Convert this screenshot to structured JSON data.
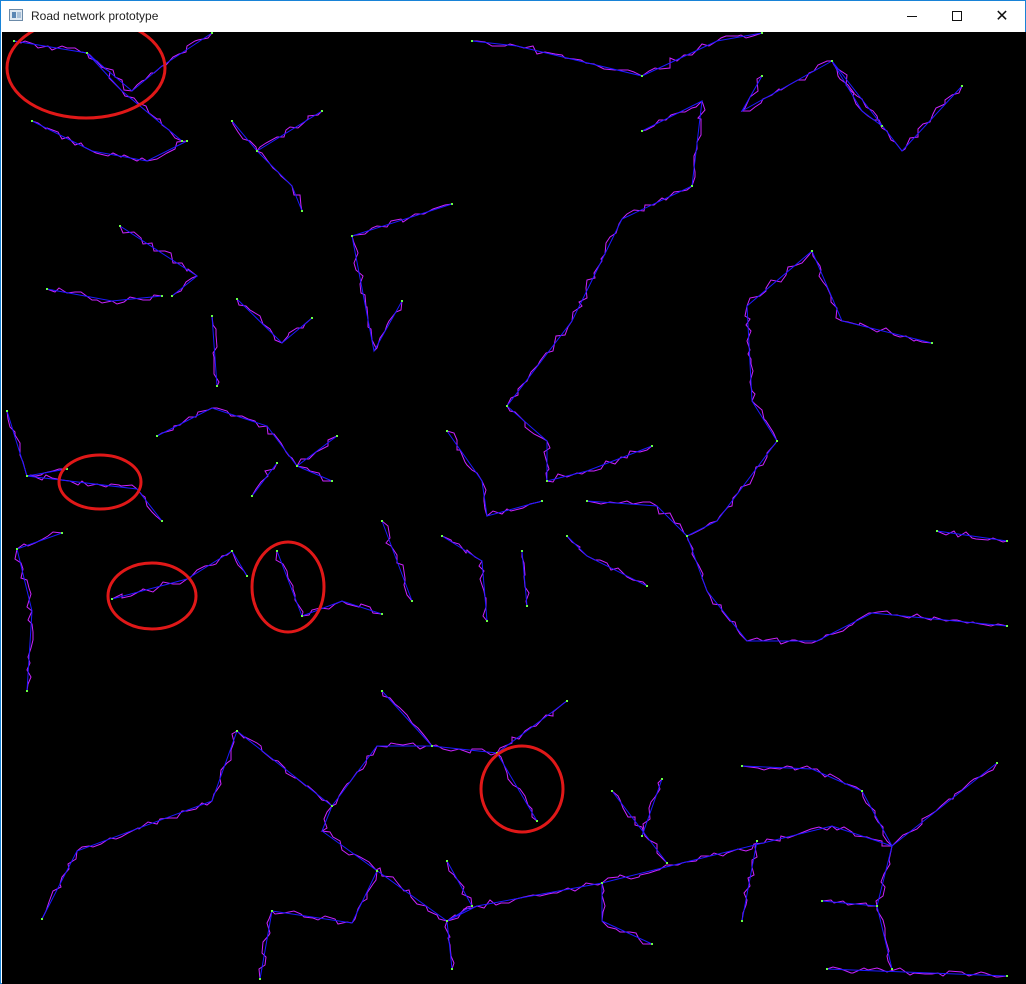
{
  "window": {
    "title": "Road network prototype",
    "controls": {
      "minimize": "minimize-icon",
      "maximize": "maximize-icon",
      "close": "close-icon"
    }
  },
  "colors": {
    "background": "#000000",
    "road": "#cc22ff",
    "link": "#1a1aff",
    "node": "#66ff44",
    "annotation": "#e01818",
    "window_border": "#1883d7"
  }
}
